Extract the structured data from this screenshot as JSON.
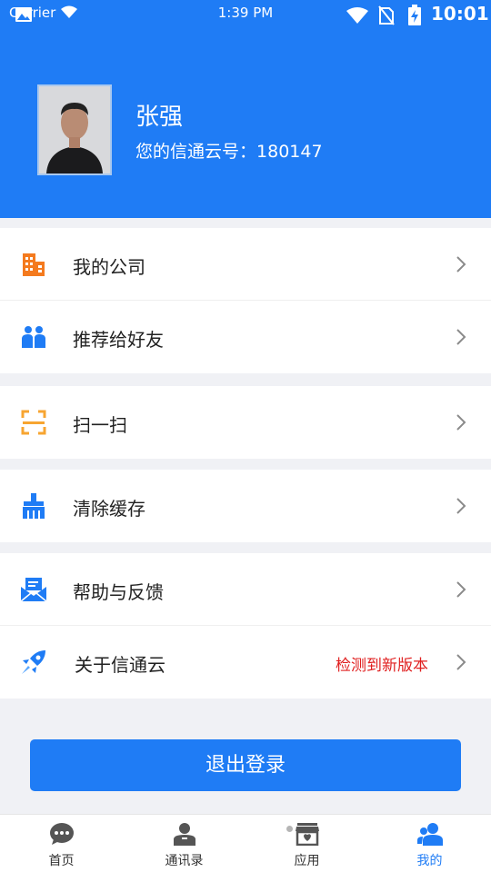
{
  "status_bar": {
    "carrier": "Carrier",
    "time": "1:39 PM",
    "clock": "10:01"
  },
  "profile": {
    "name": "张强",
    "id_label": "您的信通云号：",
    "id_value": "180147"
  },
  "menu": {
    "my_company": "我的公司",
    "recommend": "推荐给好友",
    "scan": "扫一扫",
    "clear_cache": "清除缓存",
    "help_feedback": "帮助与反馈",
    "about": "关于信通云",
    "update_notice": "检测到新版本"
  },
  "logout_label": "退出登录",
  "tabs": {
    "home": "首页",
    "contacts": "通讯录",
    "apps": "应用",
    "mine": "我的"
  },
  "colors": {
    "brand_blue": "#1f7cf5",
    "update_red": "#e02020",
    "orange": "#f47a1e"
  }
}
